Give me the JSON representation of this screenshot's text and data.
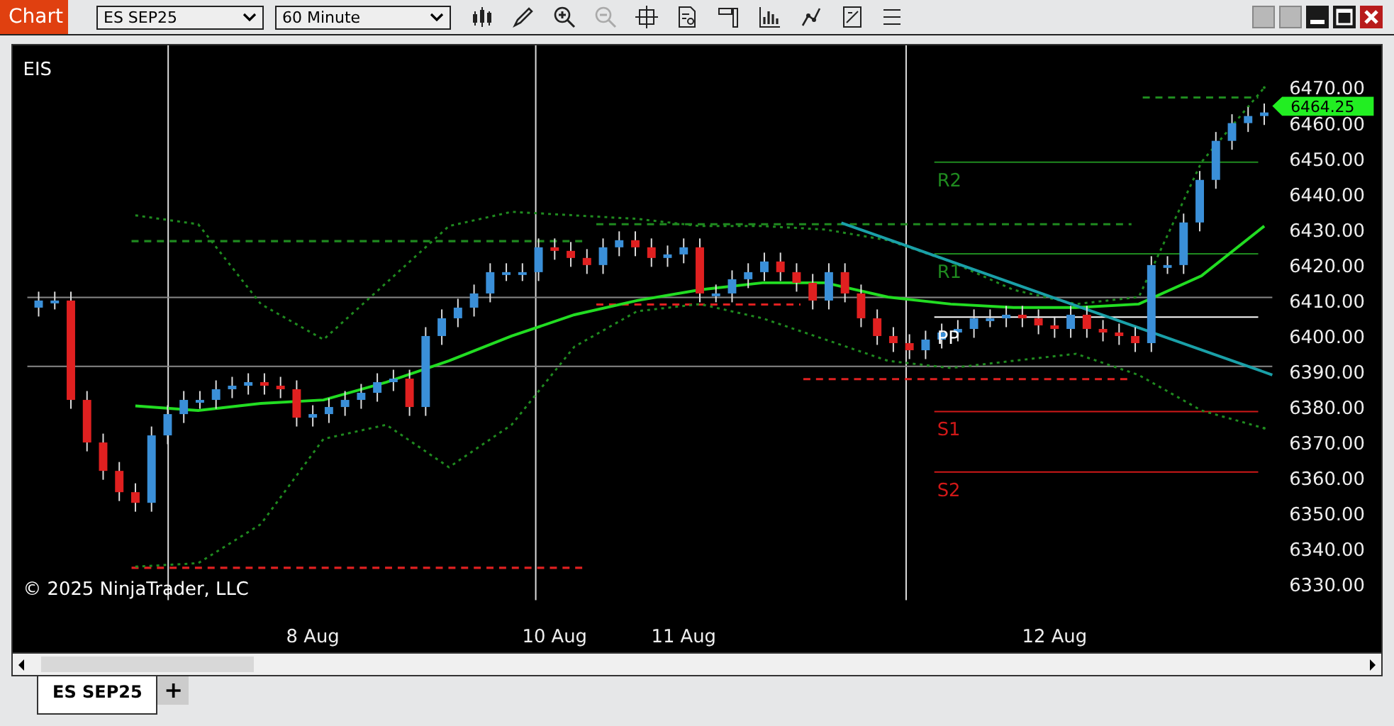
{
  "window": {
    "title": "Chart"
  },
  "toolbar": {
    "instrument": "ES SEP25",
    "interval": "60 Minute"
  },
  "chart": {
    "instrument_label": "EIS",
    "copyright": "© 2025 NinjaTrader, LLC",
    "current_price": "6464.25",
    "pivot_labels": [
      "R2",
      "R1",
      "PP",
      "S1",
      "S2"
    ],
    "chart_data": {
      "type": "candlestick",
      "ylim": [
        6330,
        6470
      ],
      "categories": [
        null,
        null,
        null,
        null,
        null,
        null,
        null,
        null,
        null,
        null,
        null,
        null,
        null,
        null,
        null,
        null,
        null,
        "8 Aug",
        null,
        null,
        null,
        null,
        null,
        null,
        null,
        null,
        null,
        null,
        null,
        null,
        null,
        null,
        "10 Aug",
        null,
        null,
        null,
        null,
        null,
        null,
        null,
        "11 Aug",
        null,
        null,
        null,
        null,
        null,
        null,
        null,
        null,
        null,
        null,
        null,
        null,
        null,
        null,
        null,
        null,
        null,
        null,
        null,
        null,
        null,
        null,
        "12 Aug",
        null,
        null,
        null,
        null,
        null,
        null,
        null,
        null,
        null,
        null,
        null,
        null,
        null
      ],
      "ohlc": [
        [
          6408,
          6412.5,
          6405.5,
          6410
        ],
        [
          6410,
          6412.5,
          6407.5,
          6410
        ],
        [
          6410,
          6412.5,
          6379.5,
          6382
        ],
        [
          6382,
          6384.5,
          6367.5,
          6370
        ],
        [
          6370,
          6372.5,
          6359.5,
          6362
        ],
        [
          6362,
          6364.5,
          6353.5,
          6356
        ],
        [
          6356,
          6358.5,
          6350.5,
          6353
        ],
        [
          6353,
          6374.5,
          6350.5,
          6372
        ],
        [
          6372,
          6380.5,
          6369.5,
          6378
        ],
        [
          6378,
          6384.5,
          6375.5,
          6382
        ],
        [
          6382,
          6384.5,
          6379.5,
          6382
        ],
        [
          6382,
          6387.5,
          6379.5,
          6385
        ],
        [
          6385,
          6388.5,
          6382.5,
          6386
        ],
        [
          6386,
          6389.5,
          6383.5,
          6387
        ],
        [
          6387,
          6389.5,
          6383.5,
          6386
        ],
        [
          6386,
          6388.5,
          6382.5,
          6385
        ],
        [
          6385,
          6387.5,
          6374.5,
          6377
        ],
        [
          6377,
          6380.5,
          6374.5,
          6378
        ],
        [
          6378,
          6382.5,
          6375.5,
          6380
        ],
        [
          6380,
          6384.5,
          6377.5,
          6382
        ],
        [
          6382,
          6386.5,
          6379.5,
          6384
        ],
        [
          6384,
          6389.5,
          6381.5,
          6387
        ],
        [
          6387,
          6390.5,
          6384.5,
          6388
        ],
        [
          6388,
          6390.5,
          6377.5,
          6380
        ],
        [
          6380,
          6402.5,
          6377.5,
          6400
        ],
        [
          6400,
          6407.5,
          6397.5,
          6405
        ],
        [
          6405,
          6410.5,
          6402.5,
          6408
        ],
        [
          6408,
          6414.5,
          6405.5,
          6412
        ],
        [
          6412,
          6420.5,
          6409.5,
          6418
        ],
        [
          6418,
          6420.5,
          6415.5,
          6418
        ],
        [
          6418,
          6420.5,
          6415.5,
          6418
        ],
        [
          6418,
          6427.5,
          6415.5,
          6425
        ],
        [
          6425,
          6427.5,
          6421.5,
          6424
        ],
        [
          6424,
          6426.5,
          6419.5,
          6422
        ],
        [
          6422,
          6424.5,
          6417.5,
          6420
        ],
        [
          6420,
          6427.5,
          6417.5,
          6425
        ],
        [
          6425,
          6429.5,
          6422.5,
          6427
        ],
        [
          6427,
          6429.5,
          6422.5,
          6425
        ],
        [
          6425,
          6427.5,
          6419.5,
          6422
        ],
        [
          6422,
          6425.5,
          6419.5,
          6423
        ],
        [
          6423,
          6427.5,
          6420.5,
          6425
        ],
        [
          6425,
          6427.5,
          6409.5,
          6412
        ],
        [
          6412,
          6414.5,
          6409.5,
          6412
        ],
        [
          6412,
          6418.5,
          6409.5,
          6416
        ],
        [
          6416,
          6420.5,
          6413.5,
          6418
        ],
        [
          6418,
          6423.5,
          6415.5,
          6421
        ],
        [
          6421,
          6423.5,
          6415.5,
          6418
        ],
        [
          6418,
          6420.5,
          6412.5,
          6415
        ],
        [
          6415,
          6417.5,
          6407.5,
          6410
        ],
        [
          6410,
          6420.5,
          6407.5,
          6418
        ],
        [
          6418,
          6420.5,
          6409.5,
          6412
        ],
        [
          6412,
          6414.5,
          6402.5,
          6405
        ],
        [
          6405,
          6407.5,
          6397.5,
          6400
        ],
        [
          6400,
          6402.5,
          6395.5,
          6398
        ],
        [
          6398,
          6400.5,
          6393.5,
          6396
        ],
        [
          6396,
          6401.5,
          6393.5,
          6399
        ],
        [
          6399,
          6403.5,
          6396.5,
          6401
        ],
        [
          6401,
          6404.5,
          6398.5,
          6402
        ],
        [
          6402,
          6407.5,
          6399.5,
          6405
        ],
        [
          6405,
          6407.5,
          6402.5,
          6405
        ],
        [
          6405,
          6408.5,
          6402.5,
          6406
        ],
        [
          6406,
          6408.5,
          6402.5,
          6405
        ],
        [
          6405,
          6407.5,
          6400.5,
          6403
        ],
        [
          6403,
          6405.5,
          6399.5,
          6402
        ],
        [
          6402,
          6408.5,
          6399.5,
          6406
        ],
        [
          6406,
          6408.5,
          6399.5,
          6402
        ],
        [
          6402,
          6404.5,
          6398.5,
          6401
        ],
        [
          6401,
          6403.5,
          6397.5,
          6400
        ],
        [
          6400,
          6402.5,
          6395.5,
          6398
        ],
        [
          6398,
          6422.5,
          6395.5,
          6420
        ],
        [
          6420,
          6422.5,
          6417.5,
          6420
        ],
        [
          6420,
          6434.5,
          6417.5,
          6432
        ],
        [
          6432,
          6446.5,
          6429.5,
          6444
        ],
        [
          6444,
          6457.5,
          6441.5,
          6455
        ],
        [
          6455,
          6462.5,
          6452.5,
          6460
        ],
        [
          6460,
          6464.5,
          6457.5,
          6462
        ],
        [
          6462,
          6465.5,
          6459.5,
          6463
        ]
      ],
      "yticks": [
        {
          "value": 6470,
          "label": "6470.00"
        },
        {
          "value": 6460,
          "label": "6460.00"
        },
        {
          "value": 6450,
          "label": "6450.00"
        },
        {
          "value": 6440,
          "label": "6440.00"
        },
        {
          "value": 6430,
          "label": "6430.00"
        },
        {
          "value": 6420,
          "label": "6420.00"
        },
        {
          "value": 6410,
          "label": "6410.00"
        },
        {
          "value": 6400,
          "label": "6400.00"
        },
        {
          "value": 6390,
          "label": "6390.00"
        },
        {
          "value": 6380,
          "label": "6380.00"
        },
        {
          "value": 6370,
          "label": "6370.00"
        },
        {
          "value": 6360,
          "label": "6360.00"
        },
        {
          "value": 6350,
          "label": "6350.00"
        },
        {
          "value": 6340,
          "label": "6340.00"
        },
        {
          "value": 6330,
          "label": "6330.00"
        }
      ]
    },
    "indicators": {
      "chart_data": {
        "type": "line",
        "categories": [
          null,
          null,
          null,
          null,
          null,
          null,
          null,
          null,
          null,
          null,
          null,
          null,
          null,
          null,
          null,
          null,
          null,
          null,
          null
        ],
        "ylim": [
          6330,
          6470
        ],
        "series": [
          {
            "color": "#22dd22",
            "line_style": "solid",
            "values": [
              6380.3,
              6379,
              6381,
              6382,
              6387,
              6393,
              6400,
              6406,
              6410,
              6413,
              6415,
              6415,
              6411,
              6409,
              6408,
              6408,
              6409,
              6417,
              6431
            ]
          },
          {
            "color": "#1f8a1f",
            "line_style": "dotted",
            "values": [
              6434,
              6431.5,
              6409,
              6399,
              6415,
              6431,
              6435,
              6434,
              6433,
              6431,
              6431,
              6430,
              6427,
              6421,
              6413,
              6409,
              6411,
              6449,
              6470
            ]
          },
          {
            "color": "#1f8a1f",
            "line_style": "dotted",
            "values": [
              6335,
              6336,
              6347,
              6371,
              6375,
              6363,
              6375,
              6397,
              6407,
              6409,
              6405,
              6399,
              6393,
              6391,
              6393,
              6395,
              6389,
              6379,
              6374
            ]
          }
        ]
      }
    }
  },
  "tabs": [
    {
      "label": "ES SEP25",
      "selected": true
    }
  ],
  "add_tab": "+"
}
